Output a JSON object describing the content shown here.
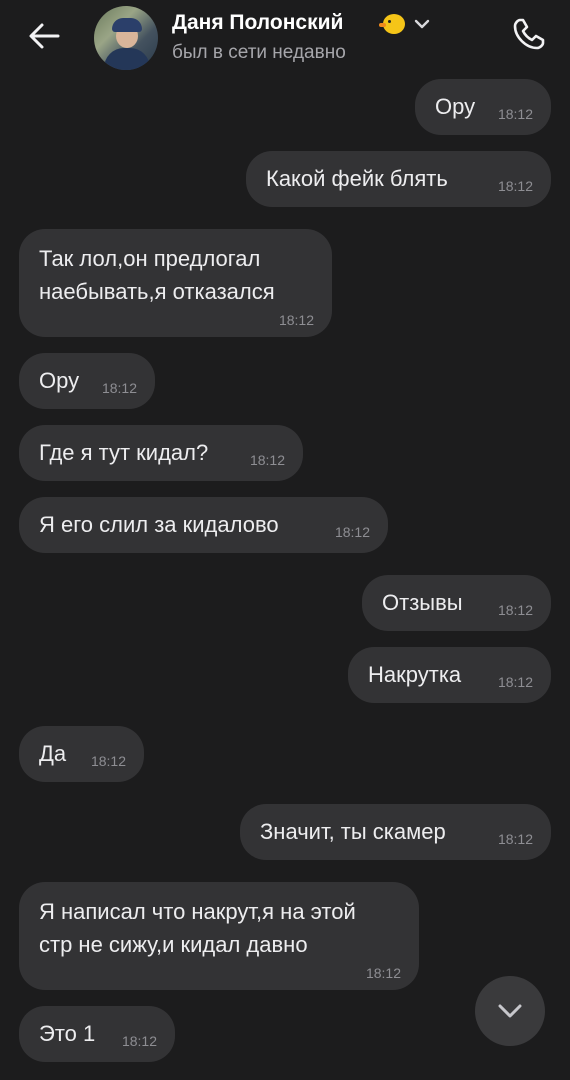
{
  "header": {
    "contact_name": "Даня Полонский",
    "status": "был в сети недавно",
    "emoji_icon": "chick-emoji",
    "back_icon": "arrow-left-icon",
    "call_icon": "phone-icon",
    "dropdown_icon": "chevron-down-icon"
  },
  "messages": [
    {
      "direction": "outgoing",
      "lines": [
        "Ору"
      ],
      "time": "18:12"
    },
    {
      "direction": "outgoing",
      "lines": [
        "Какой фейк блять"
      ],
      "time": "18:12"
    },
    {
      "direction": "incoming",
      "lines": [
        "Так лол,он предлогал",
        "наебывать,я отказался"
      ],
      "time": "18:12"
    },
    {
      "direction": "incoming",
      "lines": [
        "Ору"
      ],
      "time": "18:12"
    },
    {
      "direction": "incoming",
      "lines": [
        "Где я тут кидал?"
      ],
      "time": "18:12"
    },
    {
      "direction": "incoming",
      "lines": [
        "Я его слил за кидалово"
      ],
      "time": "18:12"
    },
    {
      "direction": "outgoing",
      "lines": [
        "Отзывы"
      ],
      "time": "18:12"
    },
    {
      "direction": "outgoing",
      "lines": [
        "Накрутка"
      ],
      "time": "18:12"
    },
    {
      "direction": "incoming",
      "lines": [
        "Да"
      ],
      "time": "18:12"
    },
    {
      "direction": "outgoing",
      "lines": [
        "Значит, ты скамер"
      ],
      "time": "18:12"
    },
    {
      "direction": "incoming",
      "lines": [
        "Я написал что накрут,я на этой",
        "стр не сижу,и кидал давно"
      ],
      "time": "18:12"
    },
    {
      "direction": "incoming",
      "lines": [
        "Это 1"
      ],
      "time": "18:12"
    }
  ],
  "scroll_button": {
    "icon": "chevron-down-icon"
  },
  "colors": {
    "background": "#1c1c1d",
    "bubble": "#333335",
    "text": "#ededef",
    "timestamp": "#8e8e93",
    "status": "#a6a6ab"
  }
}
